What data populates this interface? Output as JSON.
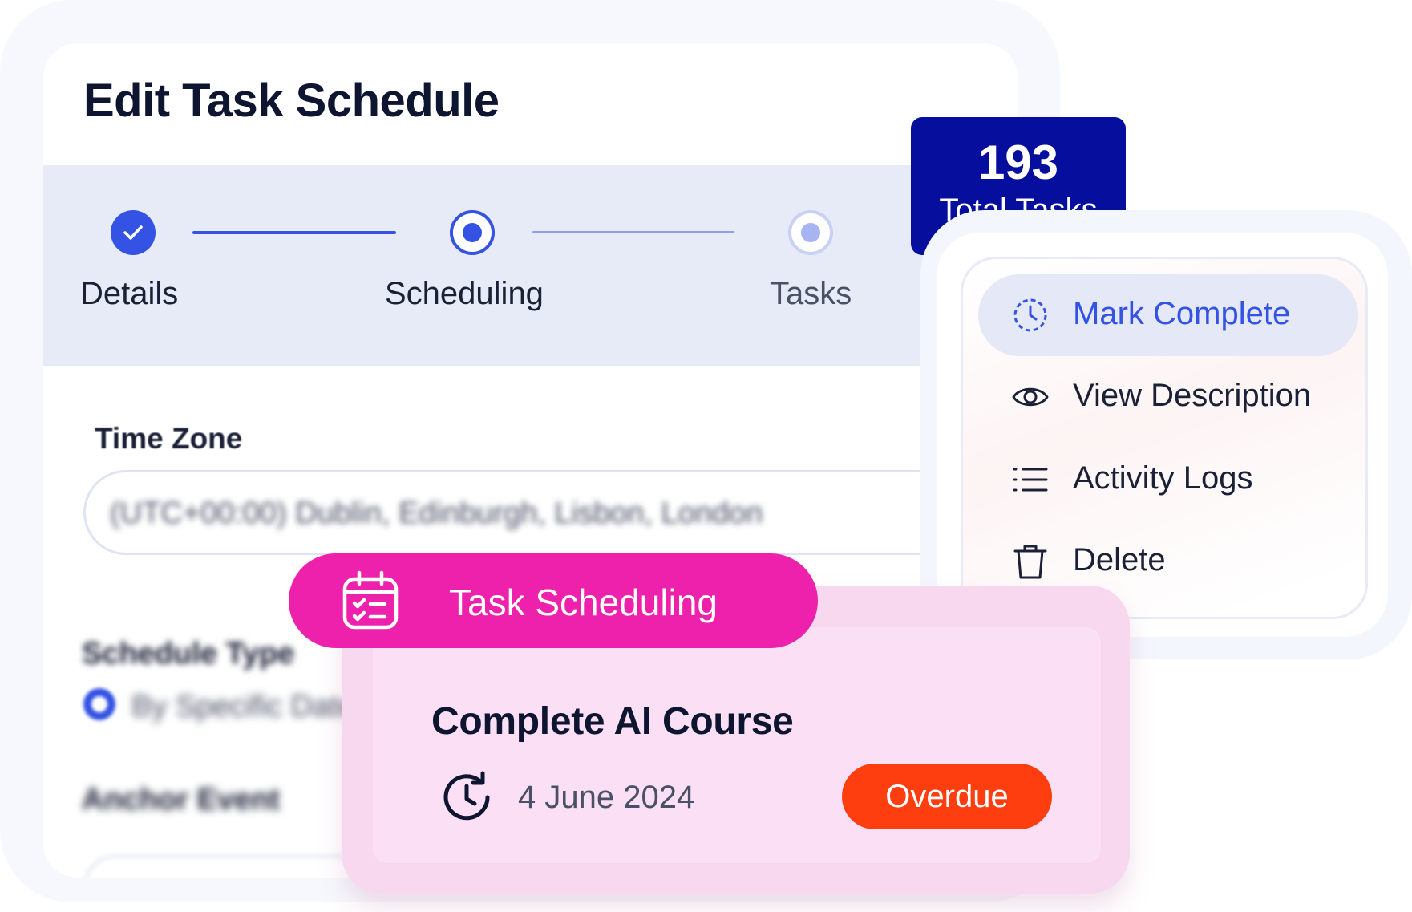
{
  "card": {
    "title": "Edit Task Schedule"
  },
  "stepper": {
    "steps": [
      {
        "label": "Details",
        "state": "completed"
      },
      {
        "label": "Scheduling",
        "state": "current"
      },
      {
        "label": "Tasks",
        "state": "upcoming"
      }
    ]
  },
  "form": {
    "time_zone_label": "Time Zone",
    "time_zone_value": "(UTC+00:00) Dublin, Edinburgh, Lisbon, London"
  },
  "total_tasks": {
    "count": "193",
    "label": "Total Tasks"
  },
  "menu": {
    "items": [
      {
        "label": "Mark Complete",
        "icon": "clock-dashed-icon",
        "active": true
      },
      {
        "label": "View Description",
        "icon": "eye-icon",
        "active": false
      },
      {
        "label": "Activity Logs",
        "icon": "list-icon",
        "active": false
      },
      {
        "label": "Delete",
        "icon": "trash-icon",
        "active": false
      }
    ]
  },
  "task_card": {
    "pill_label": "Task Scheduling",
    "pill_icon": "calendar-check-icon",
    "title": "Complete AI Course",
    "date": "4 June 2024",
    "date_icon": "clock-rotate-icon",
    "status": "Overdue"
  },
  "colors": {
    "primary": "#3452e3",
    "badge_navy": "#060e9e",
    "pill_pink": "#ee21ac",
    "overdue": "#ff3e0f",
    "stepper_bg": "#e7ebf8"
  }
}
